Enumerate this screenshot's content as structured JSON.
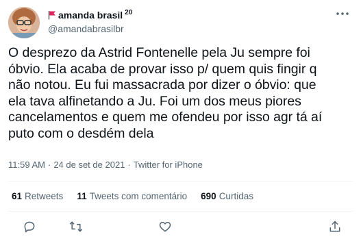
{
  "author": {
    "display_name": "amanda brasil",
    "name_suffix": "20",
    "handle": "@amandabrasilbr",
    "flag_icon": "red-flag-icon",
    "avatar": "profile-photo"
  },
  "tweet": {
    "text": "O desprezo da Astrid Fontenelle pela Ju sempre foi\nóbvio. Ela acaba de provar isso p/ quem quis fingir q\nnão notou. Eu fui massacrada por dizer o óbvio: que\nela tava alfinetando a Ju. Foi um dos meus piores\ncancelamentos e quem me ofendeu por isso agr tá aí\nputo com o desdém dela",
    "time": "11:59 AM",
    "date": "24 de set de 2021",
    "separator": "·",
    "source": "Twitter for iPhone"
  },
  "stats": {
    "retweets_count": "61",
    "retweets_label": "Retweets",
    "quotes_count": "11",
    "quotes_label": "Tweets com comentário",
    "likes_count": "690",
    "likes_label": "Curtidas"
  },
  "actions": [
    "reply-icon",
    "retweet-icon",
    "like-icon",
    "share-icon"
  ],
  "colors": {
    "text": "#0f1419",
    "secondary": "#536471",
    "divider": "#eff3f4",
    "flag": "#e0245e"
  }
}
